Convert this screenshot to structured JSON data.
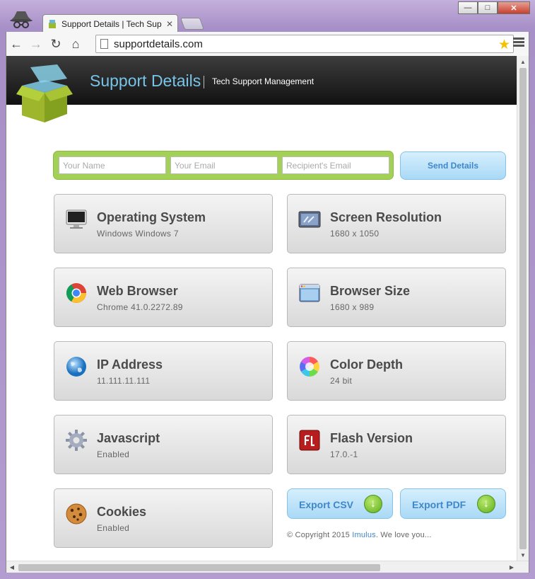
{
  "browser": {
    "tab_title": "Support Details | Tech Sup",
    "url": "supportdetails.com"
  },
  "site": {
    "title": "Support Details",
    "subtitle": "Tech Support Management"
  },
  "form": {
    "name_placeholder": "Your Name",
    "email_placeholder": "Your Email",
    "recipient_placeholder": "Recipient's Email",
    "send_label": "Send Details"
  },
  "cards": [
    {
      "title": "Operating System",
      "value": "Windows Windows 7",
      "icon": "monitor-icon"
    },
    {
      "title": "Screen Resolution",
      "value": "1680 x 1050",
      "icon": "screen-resolution-icon"
    },
    {
      "title": "Web Browser",
      "value": "Chrome 41.0.2272.89",
      "icon": "chrome-icon"
    },
    {
      "title": "Browser Size",
      "value": "1680 x 989",
      "icon": "browser-window-icon"
    },
    {
      "title": "IP Address",
      "value": "11.111.11.111",
      "icon": "globe-icon"
    },
    {
      "title": "Color Depth",
      "value": "24 bit",
      "icon": "color-wheel-icon"
    },
    {
      "title": "Javascript",
      "value": "Enabled",
      "icon": "gear-icon"
    },
    {
      "title": "Flash Version",
      "value": "17.0.-1",
      "icon": "flash-icon"
    },
    {
      "title": "Cookies",
      "value": "Enabled",
      "icon": "cookie-icon"
    }
  ],
  "export": {
    "csv_label": "Export CSV",
    "pdf_label": "Export PDF"
  },
  "footer": {
    "prefix": "© Copyright 2015 ",
    "link": "Imulus",
    "suffix": ". We love you..."
  },
  "colors": {
    "accent_blue": "#3f87c9",
    "form_green": "#a3d156",
    "header_dark": "#1e1e1e",
    "title_blue": "#78c3e8"
  }
}
